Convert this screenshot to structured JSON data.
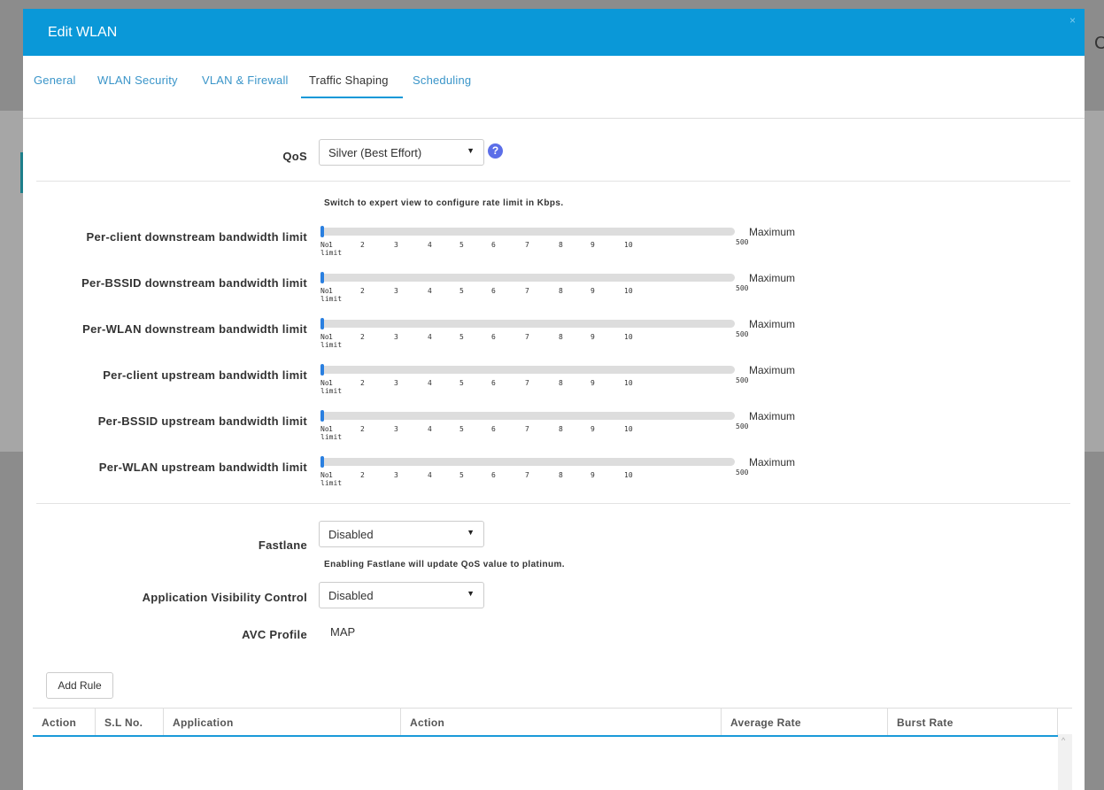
{
  "modal": {
    "title": "Edit WLAN",
    "close": "×"
  },
  "tabs": [
    {
      "label": "General",
      "active": false
    },
    {
      "label": "WLAN Security",
      "active": false
    },
    {
      "label": "VLAN & Firewall",
      "active": false
    },
    {
      "label": "Traffic Shaping",
      "active": true
    },
    {
      "label": "Scheduling",
      "active": false
    }
  ],
  "qos": {
    "label": "QoS",
    "value": "Silver (Best Effort)",
    "help": "?"
  },
  "expert_note": "Switch to expert view to configure rate limit in Kbps.",
  "slider_ticks": {
    "no": "No",
    "limit": "limit",
    "values": [
      "1",
      "2",
      "3",
      "4",
      "5",
      "6",
      "7",
      "8",
      "9",
      "10"
    ],
    "max_label": "Maximum",
    "max_value": "500"
  },
  "limits": [
    {
      "label": "Per-client downstream bandwidth limit",
      "value": "No limit"
    },
    {
      "label": "Per-BSSID downstream bandwidth limit",
      "value": "No limit"
    },
    {
      "label": "Per-WLAN downstream bandwidth limit",
      "value": "No limit"
    },
    {
      "label": "Per-client upstream bandwidth limit",
      "value": "No limit"
    },
    {
      "label": "Per-BSSID upstream bandwidth limit",
      "value": "No limit"
    },
    {
      "label": "Per-WLAN upstream bandwidth limit",
      "value": "No limit"
    }
  ],
  "fastlane": {
    "label": "Fastlane",
    "value": "Disabled",
    "note": "Enabling Fastlane will update QoS value to platinum."
  },
  "avc": {
    "label": "Application Visibility Control",
    "value": "Disabled"
  },
  "avc_profile": {
    "label": "AVC Profile",
    "value": "MAP"
  },
  "add_rule": "Add Rule",
  "table": {
    "columns": [
      "Action",
      "S.L No.",
      "Application",
      "Action",
      "Average Rate",
      "Burst Rate"
    ]
  },
  "colors": {
    "header": "#0a98d8",
    "slider_handle": "#2a7fe0",
    "help_icon": "#5b6ee8"
  }
}
